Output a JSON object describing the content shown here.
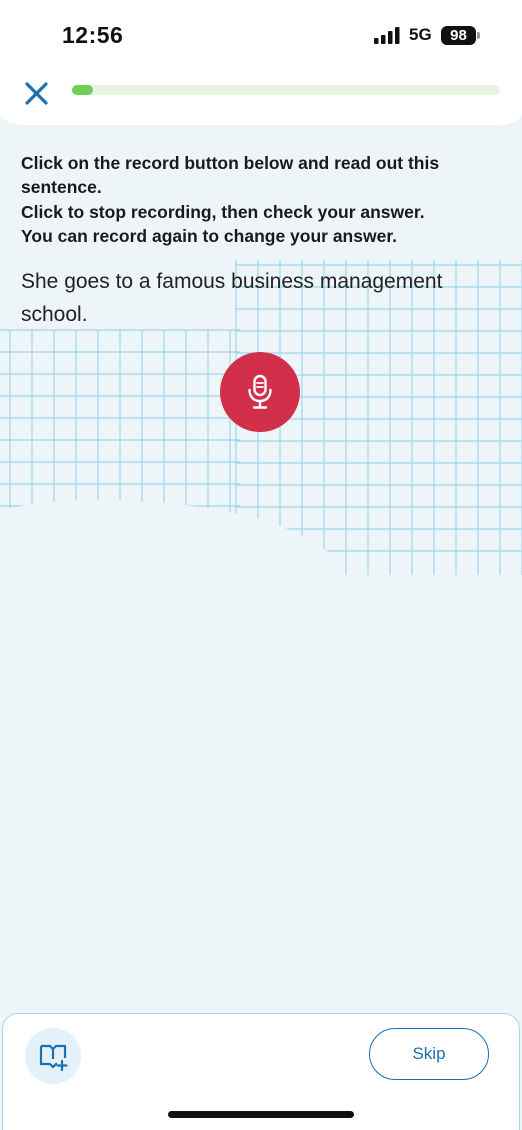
{
  "status_bar": {
    "time": "12:56",
    "network": "5G",
    "battery": "98"
  },
  "header": {
    "close_icon": "close-icon",
    "progress_fraction": 0.05,
    "progress_color": "#6fcf57"
  },
  "instructions": {
    "lines": [
      "Click on the record button below and read out this sentence.",
      "Click to stop recording, then check your answer.",
      "You can record again to change your answer."
    ]
  },
  "exercise": {
    "sentence": "She goes to a famous business management school.",
    "record_icon": "microphone-icon",
    "record_color": "#d22f4b"
  },
  "footer": {
    "vocab_icon": "book-plus-icon",
    "skip_label": "Skip"
  }
}
